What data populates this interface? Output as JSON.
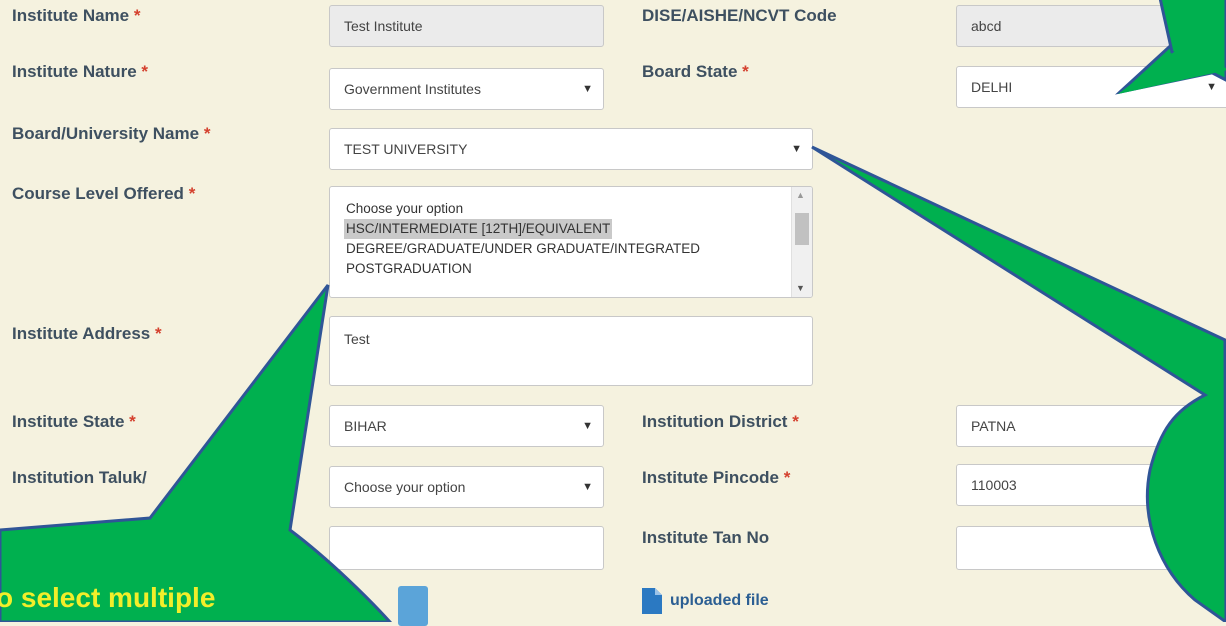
{
  "form": {
    "institute_name": {
      "label": "Institute Name",
      "value": "Test Institute"
    },
    "dise_code": {
      "label": "DISE/AISHE/NCVT Code",
      "value": "abcd"
    },
    "institute_nature": {
      "label": "Institute Nature",
      "value": "Government Institutes"
    },
    "board_state": {
      "label": "Board State",
      "value": "DELHI"
    },
    "board_university": {
      "label": "Board/University Name",
      "value": "TEST UNIVERSITY"
    },
    "course_level": {
      "label": "Course Level Offered",
      "options": [
        "Choose your option",
        "HSC/INTERMEDIATE [12TH]/EQUIVALENT",
        "DEGREE/GRADUATE/UNDER GRADUATE/INTEGRATED",
        "POSTGRADUATION"
      ],
      "selected": "HSC/INTERMEDIATE [12TH]/EQUIVALENT"
    },
    "institute_address": {
      "label": "Institute Address",
      "value": "Test"
    },
    "institute_state": {
      "label": "Institute State",
      "value": "BIHAR"
    },
    "institution_district": {
      "label": "Institution District",
      "value": "PATNA"
    },
    "institution_taluk": {
      "label": "Institution Taluk/",
      "value": "Choose your option"
    },
    "institute_pincode": {
      "label": "Institute Pincode",
      "value": "110003"
    },
    "institute_tan": {
      "label": "Institute Tan No",
      "value": ""
    },
    "required_marker": "*",
    "dropdown_arrow": "▼"
  },
  "upload": {
    "label": "uploaded file",
    "icon": "file-icon",
    "color": "#2b79c2"
  },
  "callouts": {
    "color": "#00b04f",
    "outline": "#2f5597",
    "text_color": "#f2ee2a",
    "left_text": "o select multiple"
  }
}
